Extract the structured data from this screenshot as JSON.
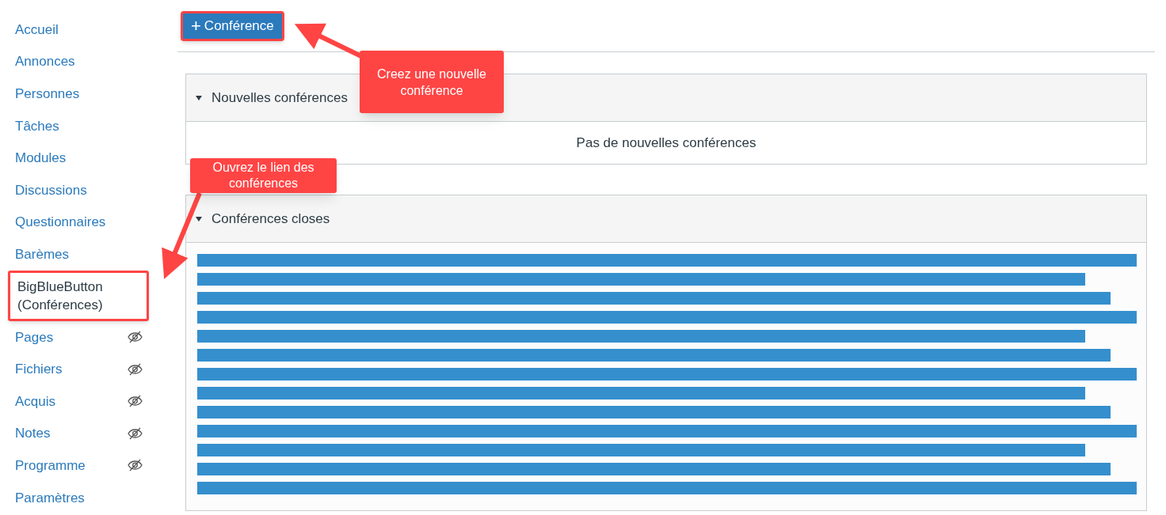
{
  "sidebar": {
    "items": [
      {
        "label": "Accueil",
        "selected": false,
        "hidden": false
      },
      {
        "label": "Annonces",
        "selected": false,
        "hidden": false
      },
      {
        "label": "Personnes",
        "selected": false,
        "hidden": false
      },
      {
        "label": "Tâches",
        "selected": false,
        "hidden": false
      },
      {
        "label": "Modules",
        "selected": false,
        "hidden": false
      },
      {
        "label": "Discussions",
        "selected": false,
        "hidden": false
      },
      {
        "label": "Questionnaires",
        "selected": false,
        "hidden": false
      },
      {
        "label": "Barèmes",
        "selected": false,
        "hidden": false
      },
      {
        "label": "BigBlueButton (Conférences)",
        "selected": true,
        "hidden": false
      },
      {
        "label": "Pages",
        "selected": false,
        "hidden": true
      },
      {
        "label": "Fichiers",
        "selected": false,
        "hidden": true
      },
      {
        "label": "Acquis",
        "selected": false,
        "hidden": true
      },
      {
        "label": "Notes",
        "selected": false,
        "hidden": true
      },
      {
        "label": "Programme",
        "selected": false,
        "hidden": true
      },
      {
        "label": "Paramètres",
        "selected": false,
        "hidden": false
      }
    ]
  },
  "add_button": {
    "icon": "+",
    "label": "Conférence"
  },
  "sections": [
    {
      "title": "Nouvelles conférences",
      "expanded": true,
      "empty_text": "Pas de nouvelles conférences"
    },
    {
      "title": "Conférences closes",
      "expanded": true
    }
  ],
  "annotations": [
    {
      "text": "Creez une nouvelle conférence"
    },
    {
      "text": "Ouvrez le lien des conférences"
    }
  ]
}
